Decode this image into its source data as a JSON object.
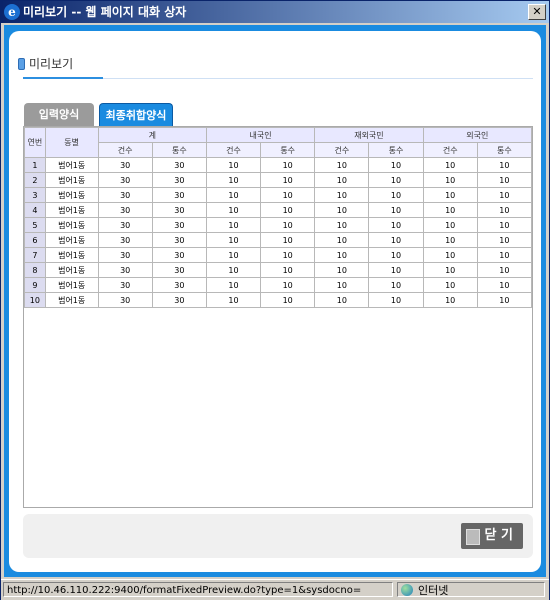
{
  "window": {
    "title": "미리보기 -- 웹 페이지 대화 상자",
    "close_glyph": "✕"
  },
  "page": {
    "heading": "미리보기"
  },
  "tabs": [
    {
      "label": "입력양식"
    },
    {
      "label": "최종취합양식"
    }
  ],
  "table": {
    "col_headers": {
      "no": "연번",
      "dong": "동별"
    },
    "groups": [
      "계",
      "내국인",
      "재외국민",
      "외국인"
    ],
    "subheaders": [
      "건수",
      "통수"
    ],
    "rows": [
      {
        "no": "1",
        "dong": "범어1동",
        "vals": [
          "30",
          "30",
          "10",
          "10",
          "10",
          "10",
          "10",
          "10"
        ]
      },
      {
        "no": "2",
        "dong": "범어1동",
        "vals": [
          "30",
          "30",
          "10",
          "10",
          "10",
          "10",
          "10",
          "10"
        ]
      },
      {
        "no": "3",
        "dong": "범어1동",
        "vals": [
          "30",
          "30",
          "10",
          "10",
          "10",
          "10",
          "10",
          "10"
        ]
      },
      {
        "no": "4",
        "dong": "범어1동",
        "vals": [
          "30",
          "30",
          "10",
          "10",
          "10",
          "10",
          "10",
          "10"
        ]
      },
      {
        "no": "5",
        "dong": "범어1동",
        "vals": [
          "30",
          "30",
          "10",
          "10",
          "10",
          "10",
          "10",
          "10"
        ]
      },
      {
        "no": "6",
        "dong": "범어1동",
        "vals": [
          "30",
          "30",
          "10",
          "10",
          "10",
          "10",
          "10",
          "10"
        ]
      },
      {
        "no": "7",
        "dong": "범어1동",
        "vals": [
          "30",
          "30",
          "10",
          "10",
          "10",
          "10",
          "10",
          "10"
        ]
      },
      {
        "no": "8",
        "dong": "범어1동",
        "vals": [
          "30",
          "30",
          "10",
          "10",
          "10",
          "10",
          "10",
          "10"
        ]
      },
      {
        "no": "9",
        "dong": "범어1동",
        "vals": [
          "30",
          "30",
          "10",
          "10",
          "10",
          "10",
          "10",
          "10"
        ]
      },
      {
        "no": "10",
        "dong": "범어1동",
        "vals": [
          "30",
          "30",
          "10",
          "10",
          "10",
          "10",
          "10",
          "10"
        ]
      }
    ]
  },
  "footer": {
    "close_label": "닫 기"
  },
  "statusbar": {
    "url": "http://10.46.110.222:9400/formatFixedPreview.do?type=1&sysdocno=",
    "zone": "인터넷"
  },
  "colors": {
    "accent": "#1a8be0",
    "header_bg": "#e8e8ff",
    "titlebar": "#0a246a"
  },
  "icons": {
    "app": "ie-icon",
    "close": "close-icon",
    "heading": "bullet-icon",
    "zone": "globe-icon"
  }
}
